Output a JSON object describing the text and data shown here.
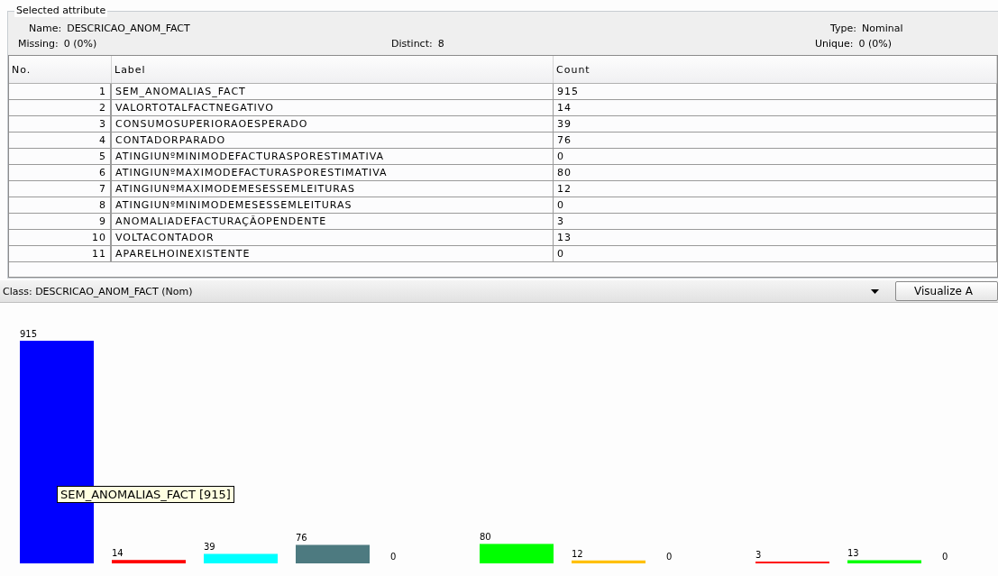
{
  "selected_attribute": {
    "title": "Selected attribute",
    "fields": [
      {
        "label": "Name:",
        "value": "DESCRICAO_ANOM_FACT"
      },
      {
        "label": "Type:",
        "value": "Nominal"
      },
      {
        "label": "Missing:",
        "value": "0 (0%)"
      },
      {
        "label": "Distinct:",
        "value": "8"
      },
      {
        "label": "Unique:",
        "value": "0 (0%)"
      }
    ]
  },
  "table": {
    "columns": [
      "No.",
      "Label",
      "Count"
    ],
    "rows": [
      [
        "1",
        "SEM_ANOMALIAS_FACT",
        "915"
      ],
      [
        "2",
        "VALORTOTALFACTNEGATIVO",
        "14"
      ],
      [
        "3",
        "CONSUMOSUPERIORAOESPERADO",
        "39"
      ],
      [
        "4",
        "CONTADORPARADO",
        "76"
      ],
      [
        "5",
        "ATINGIUNºMINIMODEFACTURASPORESTIMATIVA",
        "0"
      ],
      [
        "6",
        "ATINGIUNºMAXIMODEFACTURASPORESTIMATIVA",
        "80"
      ],
      [
        "7",
        "ATINGIUNºMAXIMODEMESESSEMLEITURAS",
        "12"
      ],
      [
        "8",
        "ATINGIUNºMINIMODEMESESSEMLEITURAS",
        "0"
      ],
      [
        "9",
        "ANOMALIADEFACTURAÇÃOPENDENTE",
        "3"
      ],
      [
        "10",
        "VOLTACONTADOR",
        "13"
      ],
      [
        "11",
        "APARELHOINEXISTENTE",
        "0"
      ]
    ]
  },
  "class_selector": {
    "value": "Class: DESCRICAO_ANOM_FACT (Nom)"
  },
  "visualize_button": {
    "label": "Visualize A"
  },
  "histogram": {
    "bars": [
      {
        "value_label": "915",
        "color": "#0000ff"
      },
      {
        "value_label": "14",
        "color": "#ff0000"
      },
      {
        "value_label": "39",
        "color": "#00ffff"
      },
      {
        "value_label": "76",
        "color": "#4d7a80"
      },
      {
        "value_label": "0"
      },
      {
        "value_label": "80",
        "color": "#00ff00"
      },
      {
        "value_label": "12",
        "color": "#ffc000"
      },
      {
        "value_label": "0"
      },
      {
        "value_label": "3",
        "color": "#ff0000"
      },
      {
        "value_label": "13",
        "color": "#00ff00"
      },
      {
        "value_label": "0"
      }
    ],
    "tooltip": "SEM_ANOMALIAS_FACT [915]"
  }
}
